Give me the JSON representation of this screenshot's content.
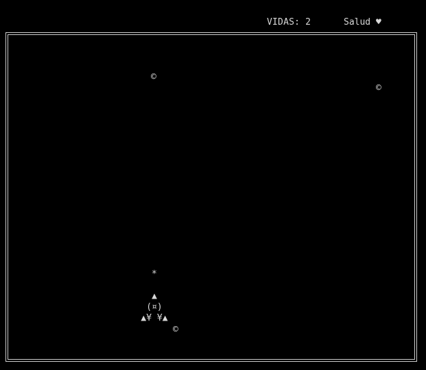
{
  "hud": {
    "lives_label": "VIDAS: 2",
    "health_label": "Salud ♥"
  },
  "game": {
    "coin_glyph": "©",
    "bullet_glyph": "*",
    "ship": {
      "row_top": "▲",
      "row_mid": "(¤)",
      "row_bottom": "▲¥ ¥▲"
    }
  },
  "colors": {
    "background": "#000000",
    "foreground": "#d8d8d8",
    "border": "#cfcfcf"
  }
}
